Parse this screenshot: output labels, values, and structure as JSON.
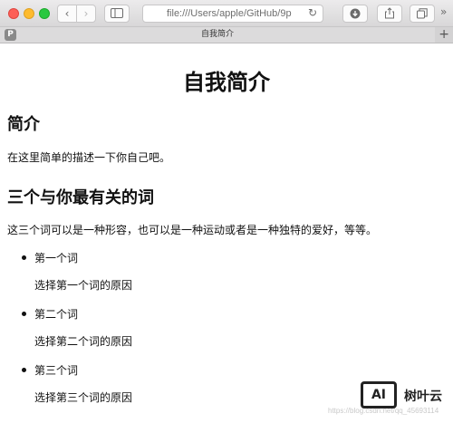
{
  "browser": {
    "address": "file:///Users/apple/GitHub/9p",
    "tab_title": "自我简介",
    "pinned_tab_letter": "P",
    "icons": [
      "back-icon",
      "forward-icon",
      "sidebar-icon",
      "reload-icon",
      "download-icon",
      "share-icon",
      "tabs-icon",
      "overflow-icon",
      "new-tab-icon"
    ]
  },
  "page": {
    "title": "自我简介",
    "section1": {
      "heading": "简介",
      "text": "在这里简单的描述一下你自己吧。"
    },
    "section2": {
      "heading": "三个与你最有关的词",
      "text": "这三个词可以是一种形容，也可以是一种运动或者是一种独特的爱好，等等。",
      "items": [
        {
          "word": "第一个词",
          "reason": "选择第一个词的原因"
        },
        {
          "word": "第二个词",
          "reason": "选择第二个词的原因"
        },
        {
          "word": "第三个词",
          "reason": "选择第三个词的原因"
        }
      ]
    }
  },
  "watermark": {
    "logo": "AI",
    "brand": "树叶云",
    "url": "https://blog.csdn.net/qq_45693114"
  }
}
